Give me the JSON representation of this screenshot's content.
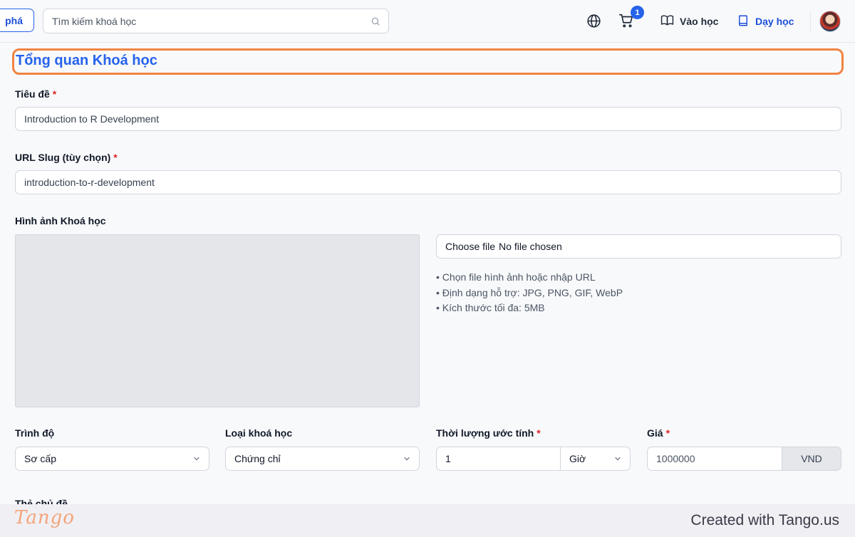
{
  "header": {
    "explore_label": "phá",
    "search_placeholder": "Tìm kiếm khoá học",
    "cart_count": "1",
    "learn_label": "Vào học",
    "teach_label": "Dạy học"
  },
  "form": {
    "section_title": "Tổng quan Khoá học",
    "title_label": "Tiêu đề",
    "title_value": "Introduction to R Development",
    "slug_label": "URL Slug (tùy chọn)",
    "slug_value": "introduction-to-r-development",
    "image_label": "Hình ảnh Khoá học",
    "file_button": "Choose file",
    "file_status": "No file chosen",
    "hints": [
      "• Chọn file hình ảnh hoặc nhập URL",
      "• Định dạng hỗ trợ: JPG, PNG, GIF, WebP",
      "• Kích thước tối đa: 5MB"
    ],
    "level_label": "Trình độ",
    "level_value": "Sơ cấp",
    "type_label": "Loại khoá học",
    "type_value": "Chứng chỉ",
    "duration_label": "Thời lượng ước tính",
    "duration_value": "1",
    "duration_unit": "Giờ",
    "price_label": "Giá",
    "price_value": "1000000",
    "currency": "VND",
    "tags_label": "Thẻ chủ đề",
    "required_mark": "*"
  },
  "footer": {
    "logo": "Tango",
    "credit": "Created with Tango.us"
  },
  "colors": {
    "accent": "#2563eb",
    "highlight": "#f08341",
    "required": "#dc2626"
  }
}
